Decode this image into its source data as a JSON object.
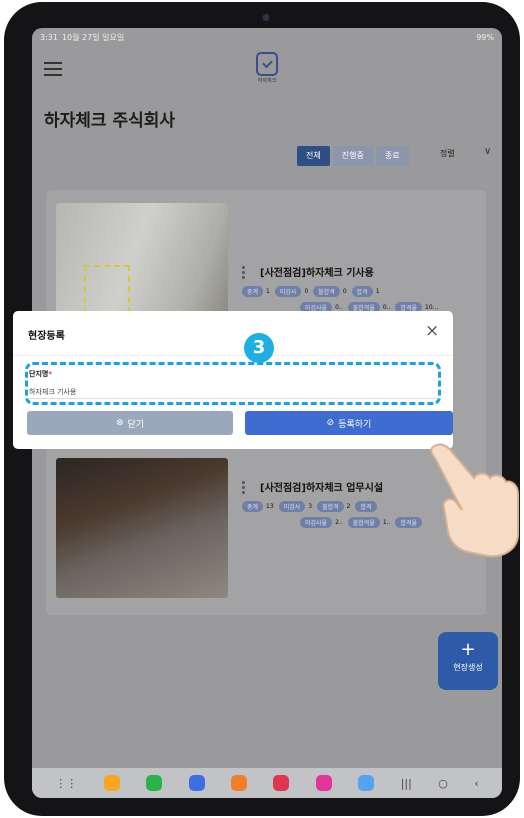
{
  "status": {
    "time": "3:31",
    "date": "10월 27일 일요일",
    "battery": "99%"
  },
  "app": {
    "logo_caption": "하자체크",
    "company_name": "하자체크 주식회사"
  },
  "filters": {
    "tabs": [
      "전체",
      "진행중",
      "종료"
    ],
    "sort_label": "정렬",
    "sort_chevron": "∨"
  },
  "sites": [
    {
      "title": "[사전점검]하자체크 기사용",
      "row1": [
        {
          "label": "총계",
          "value": "1"
        },
        {
          "label": "미검사",
          "value": "0"
        },
        {
          "label": "불합격",
          "value": "0"
        },
        {
          "label": "합격",
          "value": "1"
        }
      ],
      "row2": [
        {
          "label": "미검사율",
          "value": "0.."
        },
        {
          "label": "불합격율",
          "value": "0.."
        },
        {
          "label": "합격율",
          "value": "10..."
        }
      ]
    },
    {
      "title": "[사전점검]하자체크 업무시설",
      "row1": [
        {
          "label": "총계",
          "value": "13"
        },
        {
          "label": "미검사",
          "value": "3"
        },
        {
          "label": "불합격",
          "value": "2"
        },
        {
          "label": "합격",
          "value": ""
        }
      ],
      "row2": [
        {
          "label": "미검사율",
          "value": "2.."
        },
        {
          "label": "불합격율",
          "value": "1.."
        },
        {
          "label": "합격율",
          "value": ""
        }
      ]
    }
  ],
  "fab": {
    "plus": "+",
    "label": "현장생성"
  },
  "dialog": {
    "title": "현장등록",
    "close_glyph": "×",
    "field_label": "단지명",
    "field_required": "*",
    "field_value": "하자체크 기사용",
    "close_button": "닫기",
    "close_button_icon": "⊗",
    "register_button": "등록하기",
    "register_button_icon": "⊘"
  },
  "step_badge": "3",
  "colors": {
    "primary": "#3f6cd0",
    "accent": "#1aa3da",
    "navy": "#2e4e86"
  }
}
